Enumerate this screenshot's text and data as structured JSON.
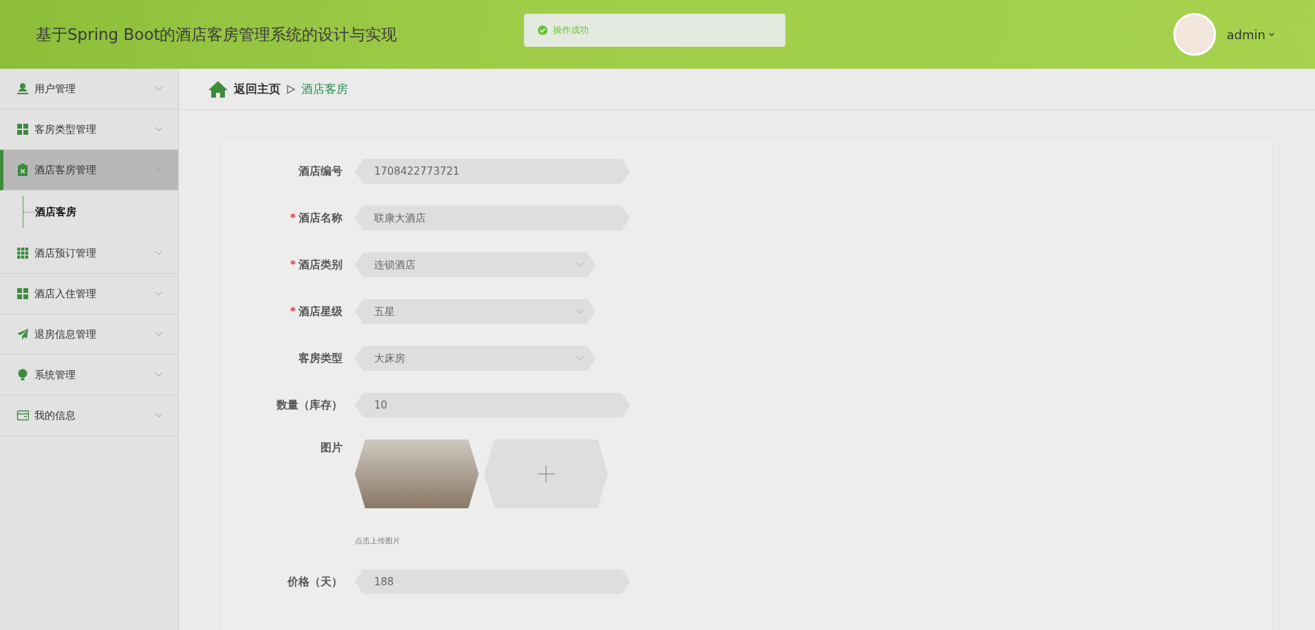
{
  "header": {
    "title": "基于Spring Boot的酒店客房管理系统的设计与实现",
    "toast": "操作成功",
    "user": "admin"
  },
  "sidebar": {
    "items": [
      {
        "label": "用户管理",
        "kind": "user",
        "expanded": false,
        "selected": false
      },
      {
        "label": "客房类型管理",
        "kind": "grid",
        "expanded": false,
        "selected": false
      },
      {
        "label": "酒店客房管理",
        "kind": "clipboard",
        "expanded": true,
        "selected": true,
        "children": [
          {
            "label": "酒店客房",
            "selected": true
          }
        ]
      },
      {
        "label": "酒店预订管理",
        "kind": "grid9",
        "expanded": false,
        "selected": false
      },
      {
        "label": "酒店入住管理",
        "kind": "grid",
        "expanded": false,
        "selected": false
      },
      {
        "label": "退房信息管理",
        "kind": "plane",
        "expanded": false,
        "selected": false
      },
      {
        "label": "系统管理",
        "kind": "bulb",
        "expanded": false,
        "selected": false
      },
      {
        "label": "我的信息",
        "kind": "card",
        "expanded": false,
        "selected": false
      }
    ]
  },
  "breadcrumb": {
    "home": "返回主页",
    "current": "酒店客房"
  },
  "form": {
    "fields": [
      {
        "label": "酒店编号",
        "kind": "text",
        "value": "1708422773721"
      },
      {
        "label": "酒店名称",
        "kind": "text",
        "required_mark": "*",
        "value": "联康大酒店"
      },
      {
        "label": "酒店类别",
        "kind": "select",
        "required_mark": "*",
        "value": "连锁酒店"
      },
      {
        "label": "酒店星级",
        "kind": "select",
        "required_mark": "*",
        "value": "五星"
      },
      {
        "label": "客房类型",
        "kind": "select",
        "value": "大床房"
      },
      {
        "label": "数量（库存）",
        "kind": "text",
        "value": "10"
      },
      {
        "label": "图片",
        "kind": "image",
        "hint": "点击上传图片"
      },
      {
        "label": "价格（天）",
        "kind": "text",
        "value": "188"
      }
    ]
  }
}
